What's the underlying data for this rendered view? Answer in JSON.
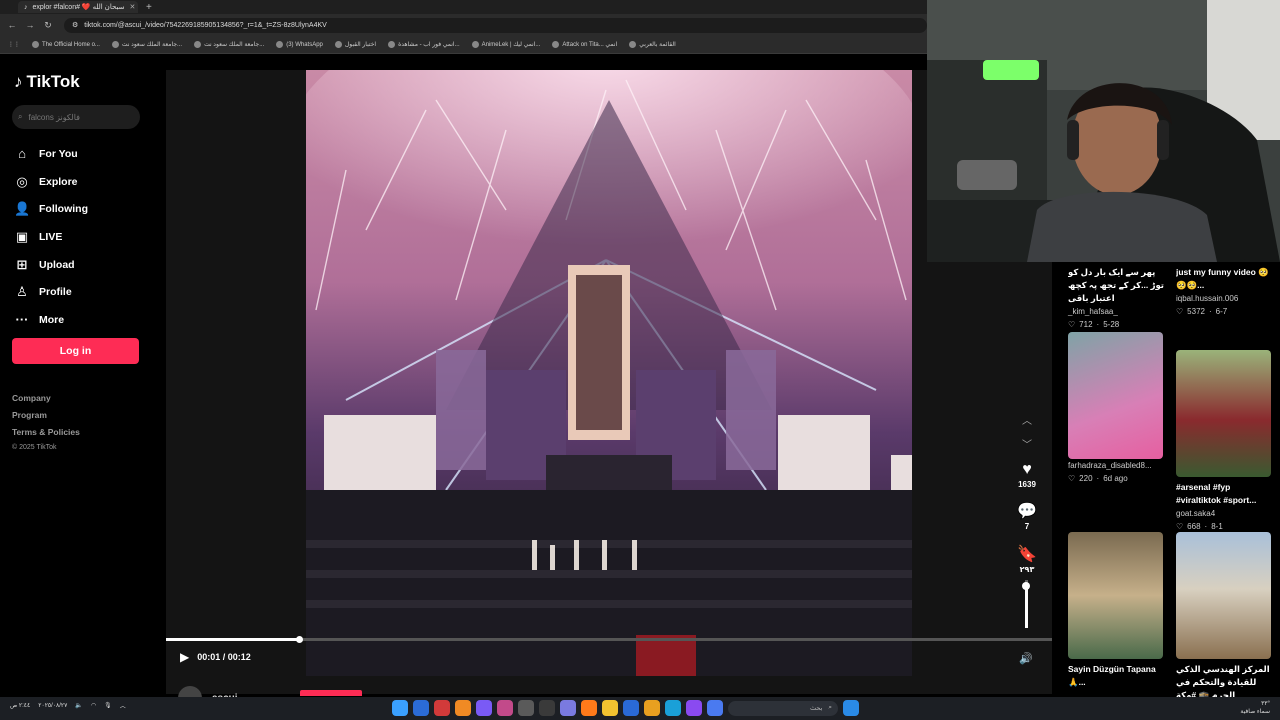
{
  "browser": {
    "tab_title": "explor #falcon# ❤️ سبحان الله",
    "url": "tiktok.com/@ascui_/video/7542269185905134856?_r=1&_t=ZS-8z8UlynA4KV",
    "bookmarks": [
      "The Official Home o...",
      "جامعة الملك سعود نت...",
      "جامعة الملك سعود نت...",
      "(3) WhatsApp",
      "اختبار القبول",
      "انمي فور اب - مشاهدة...",
      "AnimeLek | انمي ليك...",
      "Attack on Tita... انمي",
      "القائمة بالعربي"
    ]
  },
  "sidebar": {
    "logo": "TikTok",
    "search_placeholder": "falcons فالكونز",
    "nav": [
      {
        "label": "For You",
        "icon": "home-icon"
      },
      {
        "label": "Explore",
        "icon": "compass-icon"
      },
      {
        "label": "Following",
        "icon": "user-follow-icon"
      },
      {
        "label": "LIVE",
        "icon": "live-icon"
      },
      {
        "label": "Upload",
        "icon": "plus-square-icon"
      },
      {
        "label": "Profile",
        "icon": "person-icon"
      },
      {
        "label": "More",
        "icon": "ellipsis-icon"
      }
    ],
    "login_label": "Log in",
    "footer": {
      "company": "Company",
      "program": "Program",
      "terms": "Terms & Policies",
      "copyright": "© 2025 TikTok"
    }
  },
  "player": {
    "time": "00:01 / 00:12",
    "progress": 0.15,
    "volume": 0.88,
    "author": "ascui"
  },
  "actions": {
    "likes": "1639",
    "comments": "7",
    "saves": "٢٩٣"
  },
  "recommended": [
    {
      "title": "پھر سے ایک بار دل کو توڑ ...کر کے تجھ پہ کچھ اعتبار باقی",
      "user": "_kim_hafsaa_",
      "likes": "712",
      "date": "5-28"
    },
    {
      "title": "just my funny video 🥺🥺🥺...",
      "user": "iqbal.hussain.006",
      "likes": "5372",
      "date": "6-7"
    },
    {
      "title": "",
      "user": "farhadraza_disabled8...",
      "likes": "220",
      "date": "6d ago"
    },
    {
      "title": "#arsenal #fyp #viraltiktok #sport...",
      "user": "goat.saka4",
      "likes": "668",
      "date": "8-1"
    },
    {
      "title": "Sayin Düzgün Tapana 🙏...",
      "user": "",
      "likes": "",
      "date": ""
    },
    {
      "title": "المركز الهندسي الذكي للقيادة والتحكم في الحرم 🕋 #مكة",
      "user": "",
      "likes": "",
      "date": ""
    }
  ],
  "taskbar": {
    "search_label": "بحث",
    "time": "٣٣°",
    "date_label": "سماء صافية",
    "clock": "٢:٤٤ ص",
    "clock_date": "٢٠٢٥/٠٨/٢٧"
  },
  "colors": {
    "accent": "#fe2c55",
    "bg": "#000000",
    "panel": "#141414"
  }
}
